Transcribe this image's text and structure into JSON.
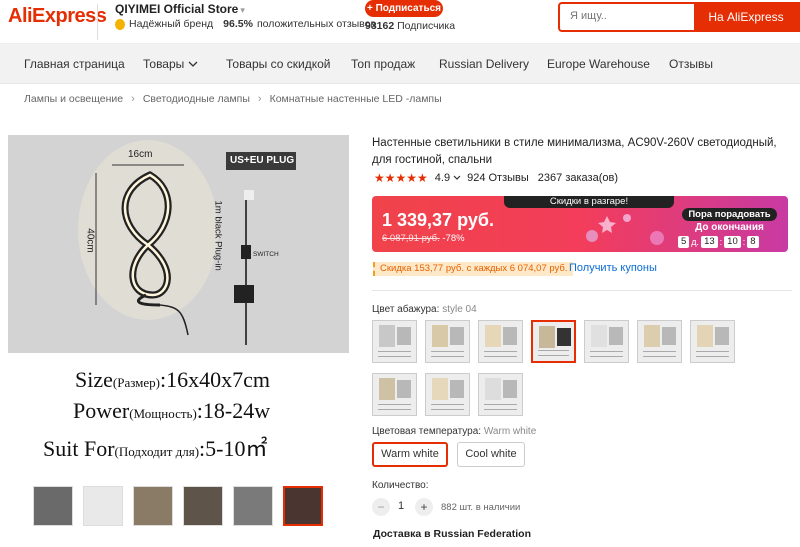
{
  "header": {
    "logo": "AliExpress",
    "store_name": "QIYIMEI Official Store",
    "store_caret": "▾",
    "brand_label": "Надёжный бренд",
    "feedback_percent": "96.5%",
    "feedback_label": "положительных отзывов",
    "subscribe_label": "+ Подписаться",
    "followers_count": "93162",
    "followers_label": "Подписчика",
    "search_placeholder": "Я ищу..",
    "search_button": "На AliExpress"
  },
  "nav": {
    "items": [
      "Главная страница",
      "Товары",
      "Товары со скидкой",
      "Топ продаж",
      "Russian Delivery",
      "Europe Warehouse",
      "Отзывы"
    ],
    "dropdown_icon": "chevron-down-icon"
  },
  "breadcrumb": [
    "Лампы и освещение",
    "Светодиодные лампы",
    "Комнатные настенные LED -лампы"
  ],
  "gallery": {
    "image_labels": {
      "width": "16cm",
      "height": "40cm",
      "plug": "US+EU PLUG",
      "cable": "1m black Plug-in",
      "switch": "SWITCH"
    },
    "caption": {
      "size_main": "Size",
      "size_small": "(Размер)",
      "size_value": ":16x40x7cm",
      "power_main": "Power",
      "power_small": "(Мощность)",
      "power_value": ":18-24w",
      "suit_main": "Suit For",
      "suit_small": "(Подходит для)",
      "suit_value": ":5-10㎡"
    },
    "thumb_count": 6,
    "selected_thumb": 6
  },
  "product": {
    "title": "Настенные светильники в стиле минимализма, AC90V-260V светодиодный, для гостиной, спальни",
    "rating": "4.9",
    "reviews": "924 Отзывы",
    "orders": "2367 заказа(ов)",
    "stars": 5
  },
  "sale": {
    "banner_title": "Скидки в разгаре!",
    "price": "1 339,37 руб.",
    "old_price": "6 087,91 руб.",
    "discount": "-78%",
    "promo_label": "Пора порадовать",
    "until_label": "До окончания",
    "timer": {
      "days": "5",
      "days_unit": "д.",
      "hours": "13",
      "minutes": "10",
      "seconds": "8"
    }
  },
  "coupon": {
    "tag": "Скидка 153,77 руб. с каждых 6 074,07 руб.",
    "link": "Получить купоны"
  },
  "options": {
    "shade_label": "Цвет абажура:",
    "shade_value": "style 04",
    "swatch_count": 10,
    "selected_swatch": 4,
    "temp_label": "Цветовая температура:",
    "temp_value": "Warm white",
    "temps": [
      "Warm white",
      "Cool white"
    ],
    "selected_temp": 0
  },
  "quantity": {
    "label": "Количество:",
    "minus": "−",
    "value": "1",
    "plus": "+",
    "stock": "882 шт. в наличии"
  },
  "shipping": "Доставка в Russian Federation",
  "colors": {
    "accent": "#e62e04",
    "link": "#0a6cd6",
    "star": "#e62e04"
  }
}
